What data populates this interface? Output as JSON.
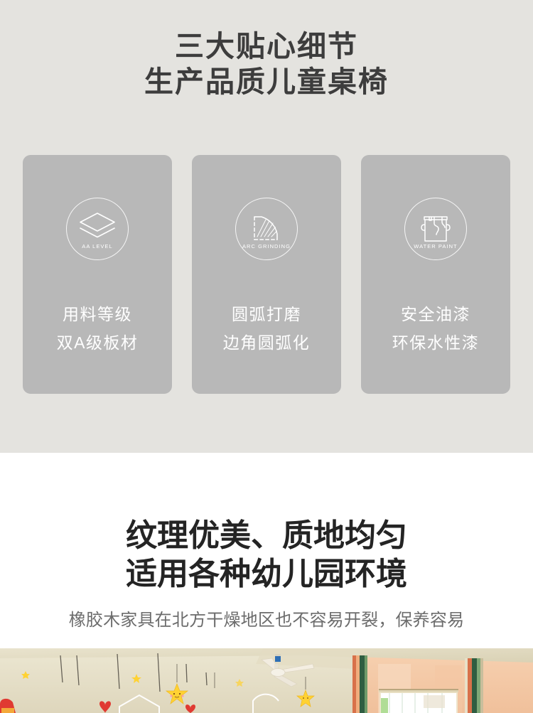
{
  "page": {
    "background_top": "#e4e3df",
    "background_bottom": "#ffffff",
    "card_color": "#b8b8b8",
    "heading_color": "#3d3d3d",
    "card_text_color": "#ffffff",
    "subtitle_color": "#6c6c6c"
  },
  "features": {
    "headline_line1": "三大贴心细节",
    "headline_line2": "生产品质儿童桌椅",
    "cards": [
      {
        "icon_name": "layers-aa-level-icon",
        "icon_caption": "AA LEVEL",
        "line1": "用料等级",
        "line2": "双A级板材"
      },
      {
        "icon_name": "arc-grinding-icon",
        "icon_caption": "ARC GRINDING",
        "line1": "圆弧打磨",
        "line2": "边角圆弧化"
      },
      {
        "icon_name": "water-paint-bucket-icon",
        "icon_caption": "WATER PAINT",
        "line1": "安全油漆",
        "line2": "环保水性漆"
      }
    ]
  },
  "texture": {
    "headline_line1": "纹理优美、质地均匀",
    "headline_line2": "适用各种幼儿园环境",
    "subtitle": "橡胶木家具在北方干燥地区也不容易开裂，保养容易"
  },
  "photo": {
    "alt": "kindergarten-classroom-photo",
    "elements": [
      "ceiling-fan",
      "hanging-star-decorations",
      "hanging-heart-decorations",
      "beige-wall",
      "peach-wall",
      "window-with-blinds",
      "green-door-frame"
    ]
  }
}
